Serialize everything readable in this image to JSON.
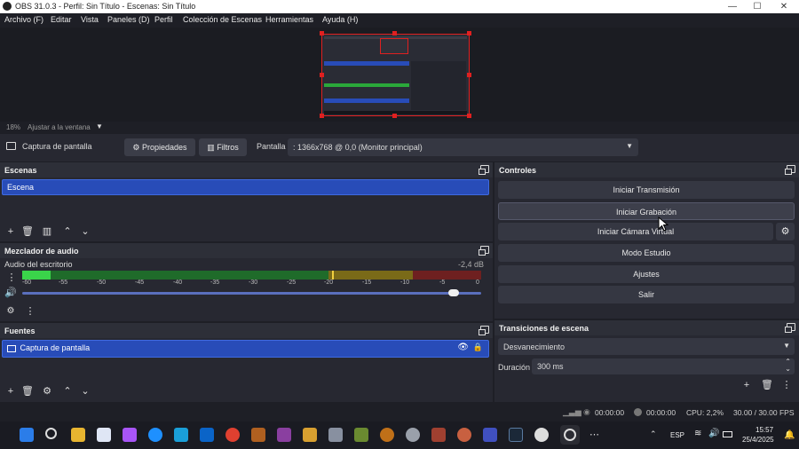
{
  "window": {
    "title": "OBS 31.0.3 - Perfil: Sin Título - Escenas: Sin Título",
    "min": "—",
    "max": "☐",
    "close": "✕"
  },
  "menu": [
    "Archivo (F)",
    "Editar",
    "Vista",
    "Paneles (D)",
    "Perfil",
    "Colección de Escenas",
    "Herramientas",
    "Ayuda (H)"
  ],
  "preview": {
    "zoom": "18%",
    "zoom_mode": "Ajustar a la ventana"
  },
  "source_toolbar": {
    "source_name": "Captura de pantalla",
    "properties": "Propiedades",
    "filters": "Filtros",
    "screen_label": "Pantalla",
    "screen_value": ": 1366x768 @ 0,0 (Monitor principal)"
  },
  "scenes": {
    "title": "Escenas",
    "items": [
      "Escena"
    ]
  },
  "mixer": {
    "title": "Mezclador de audio",
    "channel": "Audio del escritorio",
    "level": "-2,4 dB",
    "scale": [
      "-60",
      "-55",
      "-50",
      "-45",
      "-40",
      "-35",
      "-30",
      "-25",
      "-20",
      "-15",
      "-10",
      "-5",
      "0"
    ],
    "volume": 0.95
  },
  "sources": {
    "title": "Fuentes",
    "items": [
      "Captura de pantalla"
    ]
  },
  "controls": {
    "title": "Controles",
    "start_stream": "Iniciar Transmisión",
    "start_record": "Iniciar Grabación",
    "virtual_cam": "Iniciar Cámara Virtual",
    "studio_mode": "Modo Estudio",
    "settings": "Ajustes",
    "exit": "Salir"
  },
  "transitions": {
    "title": "Transiciones de escena",
    "selected": "Desvanecimiento",
    "duration_label": "Duración",
    "duration_value": "300 ms"
  },
  "status": {
    "stream_time": "00:00:00",
    "rec_time": "00:00:00",
    "cpu": "CPU: 2,2%",
    "fps": "30.00 / 30.00 FPS"
  },
  "taskbar": {
    "lang": "ESP",
    "time": "15:57",
    "date": "25/4/2025"
  },
  "colors": {
    "accent": "#284cb8",
    "meter_green": "#2aa83a",
    "meter_yellow": "#b8a020",
    "meter_red": "#b03030",
    "selection_border": "#e02020"
  }
}
